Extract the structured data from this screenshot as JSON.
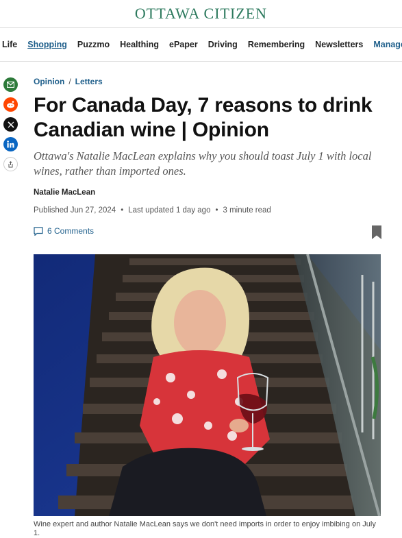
{
  "masthead": {
    "logo": "OTTAWA CITIZEN"
  },
  "nav": {
    "items": [
      {
        "label": "Life",
        "state": "normal"
      },
      {
        "label": "Shopping",
        "state": "active"
      },
      {
        "label": "Puzzmo",
        "state": "normal"
      },
      {
        "label": "Healthing",
        "state": "normal"
      },
      {
        "label": "ePaper",
        "state": "normal"
      },
      {
        "label": "Driving",
        "state": "normal"
      },
      {
        "label": "Remembering",
        "state": "normal"
      },
      {
        "label": "Newsletters",
        "state": "normal"
      },
      {
        "label": "Manage Print Sub",
        "state": "highlight"
      }
    ]
  },
  "share": {
    "icons": [
      "email-icon",
      "reddit-icon",
      "x-icon",
      "linkedin-icon",
      "share-more-icon"
    ]
  },
  "article": {
    "breadcrumb": {
      "section": "Opinion",
      "separator": "/",
      "subsection": "Letters"
    },
    "headline": "For Canada Day, 7 reasons to drink Canadian wine | Opinion",
    "subhead": "Ottawa's Natalie MacLean explains why you should toast July 1 with local wines, rather than imported ones.",
    "author": "Natalie MacLean",
    "published": "Published Jun 27, 2024",
    "updated": "Last updated 1 day ago",
    "read_time": "3 minute read",
    "dot": "•",
    "comments_label": "6 Comments",
    "caption": "Wine expert and author Natalie MacLean says we don't need imports in order to enjoy imbibing on July 1."
  },
  "colors": {
    "brand_green": "#2d7a5e",
    "link_blue": "#1f5f8b",
    "photo_wall_blue": "#1a2f7a"
  }
}
